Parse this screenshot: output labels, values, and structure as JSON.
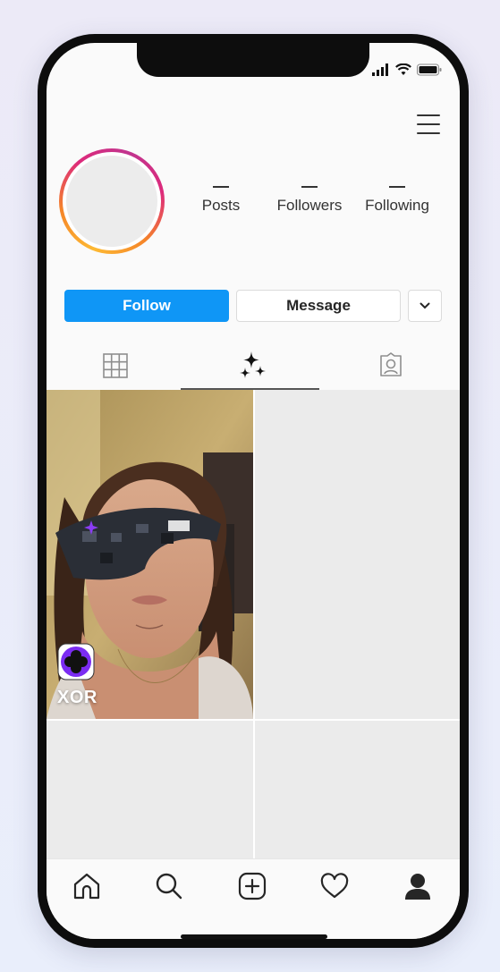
{
  "profile": {
    "stats": [
      {
        "value": "—",
        "label": "Posts"
      },
      {
        "value": "—",
        "label": "Followers"
      },
      {
        "value": "—",
        "label": "Following"
      }
    ]
  },
  "actions": {
    "follow_label": "Follow",
    "message_label": "Message",
    "more_icon": "chevron-down-icon"
  },
  "tabs": [
    {
      "name": "grid",
      "icon": "grid-icon",
      "active": false
    },
    {
      "name": "effects",
      "icon": "sparkles-icon",
      "active": true
    },
    {
      "name": "tagged",
      "icon": "tagged-person-icon",
      "active": false
    }
  ],
  "effects": [
    {
      "name": "XOR",
      "icon": "xor-effect-icon"
    }
  ],
  "bottom_nav": [
    {
      "name": "home",
      "icon": "home-icon"
    },
    {
      "name": "search",
      "icon": "search-icon"
    },
    {
      "name": "create",
      "icon": "plus-square-icon"
    },
    {
      "name": "activity",
      "icon": "heart-icon"
    },
    {
      "name": "profile",
      "icon": "profile-icon"
    }
  ],
  "colors": {
    "follow_button": "#0f96f6",
    "effect_accent": "#7b2cf2",
    "story_ring": [
      "#fdb933",
      "#f58529",
      "#dd2a7b"
    ]
  }
}
